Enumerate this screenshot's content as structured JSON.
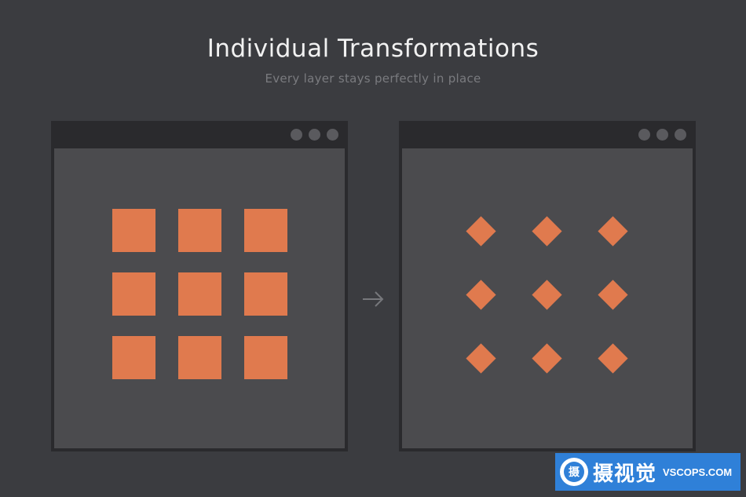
{
  "header": {
    "title": "Individual Transformations",
    "subtitle": "Every layer stays perfectly in place"
  },
  "left_window": {
    "shape": "square",
    "rows": 3,
    "cols": 3,
    "color": "#e07a4e"
  },
  "right_window": {
    "shape": "diamond",
    "rows": 3,
    "cols": 3,
    "rotation_deg": 45,
    "color": "#e07a4e"
  },
  "arrow_icon": "right-arrow-icon",
  "colors": {
    "background": "#3b3c40",
    "window_frame": "#2a2a2d",
    "window_content": "#4b4b4e",
    "accent": "#e07a4e",
    "watermark_bg": "#2f80d8"
  },
  "watermark": {
    "logo_char": "摄",
    "text_cn": "摄视觉",
    "text_en": "VSCOPS.COM"
  }
}
